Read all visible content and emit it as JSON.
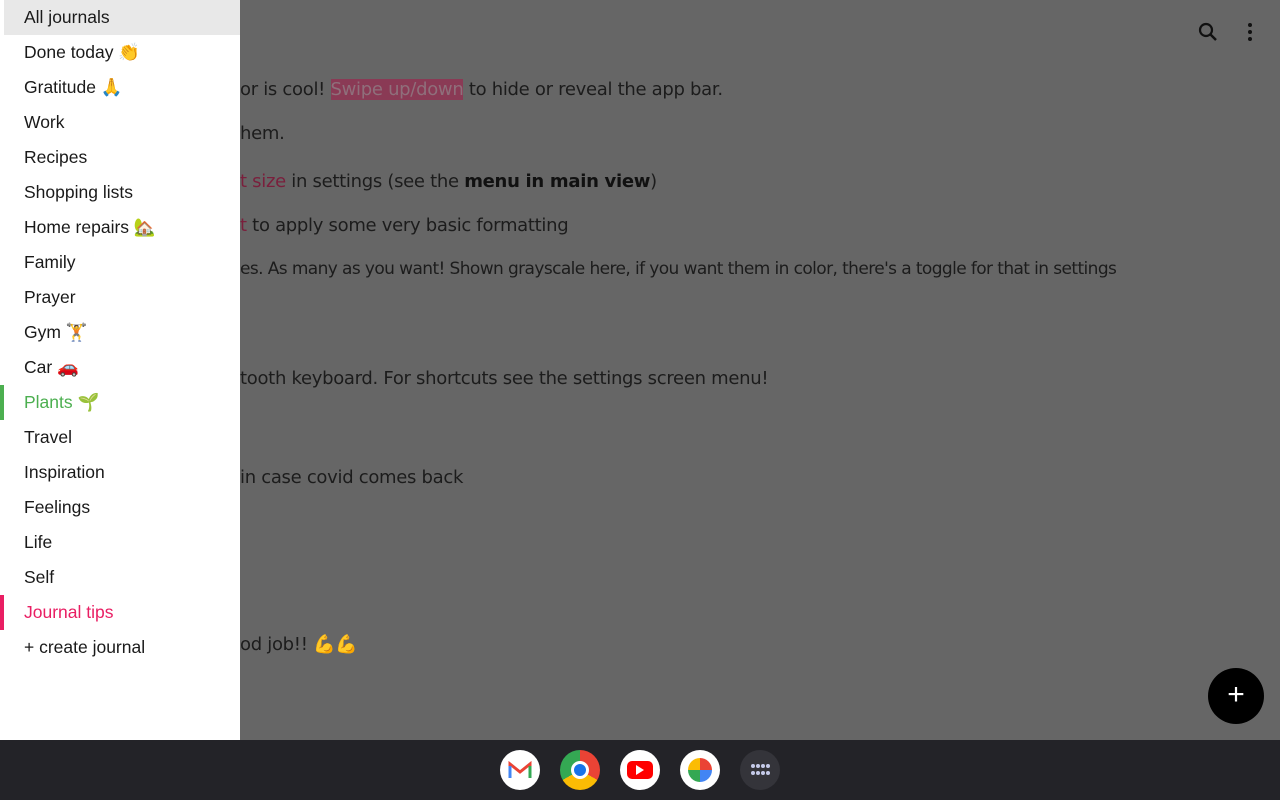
{
  "drawer": {
    "items": [
      {
        "label": "All journals"
      },
      {
        "label": "Done today 👏"
      },
      {
        "label": "Gratitude 🙏"
      },
      {
        "label": "Work"
      },
      {
        "label": "Recipes"
      },
      {
        "label": "Shopping lists"
      },
      {
        "label": "Home repairs 🏡"
      },
      {
        "label": "Family"
      },
      {
        "label": "Prayer"
      },
      {
        "label": "Gym 🏋"
      },
      {
        "label": "Car 🚗"
      },
      {
        "label": "Plants 🌱",
        "color": "#4caf50"
      },
      {
        "label": "Travel"
      },
      {
        "label": "Inspiration"
      },
      {
        "label": "Feelings"
      },
      {
        "label": "Life"
      },
      {
        "label": "Self"
      },
      {
        "label": "Journal tips",
        "color": "#e91e63"
      },
      {
        "label": "+ create journal"
      }
    ]
  },
  "main": {
    "lines": [
      [
        "or is cool! ",
        "Swipe up/down",
        " to hide or reveal the app bar."
      ],
      [
        "hem."
      ],
      [
        "t size",
        " in settings (see the ",
        "menu in main view",
        ")"
      ],
      [
        "t",
        " to apply some very basic formatting"
      ],
      [
        "es. As many as you want! Shown grayscale here, if you want them in color, there's a toggle for that in settings"
      ],
      [
        "tooth keyboard. For shortcuts see the settings screen menu!"
      ],
      [
        " in case covid comes back"
      ],
      [
        "od job!! ",
        "💪💪"
      ]
    ]
  },
  "toolbar": {
    "search_icon": "search-icon",
    "more_icon": "more-vert-icon"
  },
  "fab": {
    "label": "+"
  },
  "shelf": {
    "apps": [
      "Gmail",
      "Chrome",
      "YouTube",
      "Photos",
      "App launcher"
    ]
  }
}
